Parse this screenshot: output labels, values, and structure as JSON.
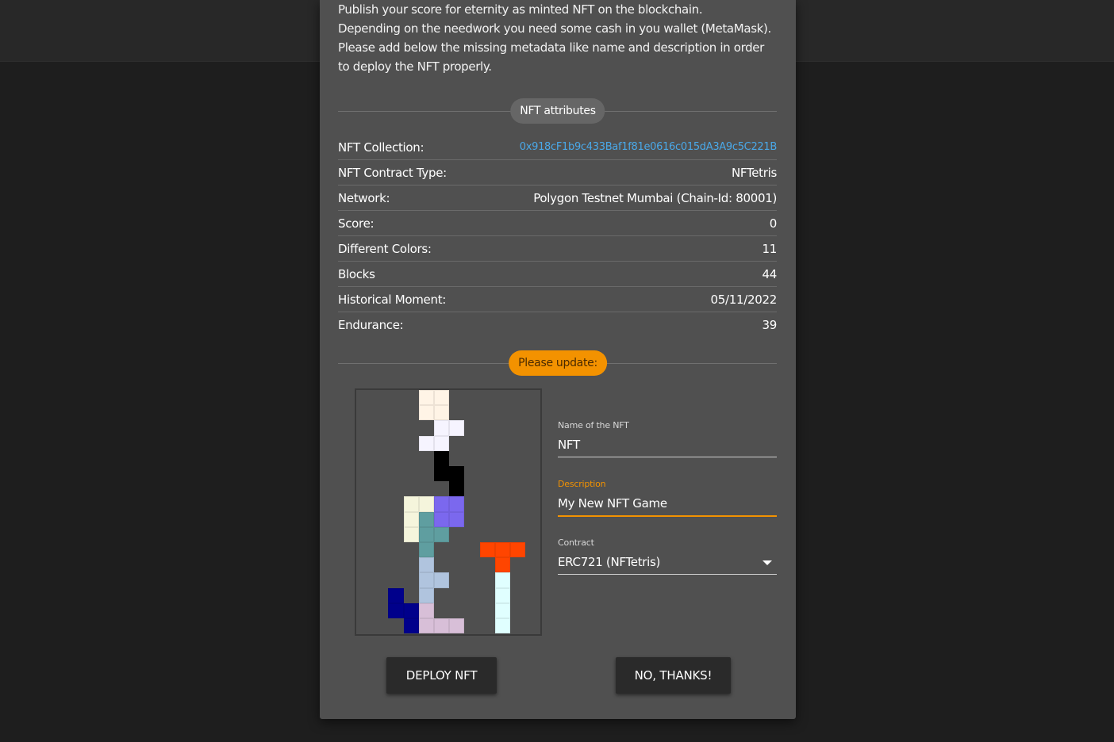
{
  "dialog": {
    "intro": "Publish your score for eternity as minted NFT on the blockchain.\nDepending on the needwork you need some cash in you wallet (MetaMask).\nPlease add below the missing metadata like name and description in order\nto deploy the NFT properly.",
    "attributes_chip": "NFT attributes",
    "attributes": [
      {
        "label": "NFT Collection:",
        "value": "0x918cF1b9c433Baf1f81e0616c015dA3A9c5C221B",
        "is_link": true
      },
      {
        "label": "NFT Contract Type:",
        "value": "NFTetris"
      },
      {
        "label": "Network:",
        "value": "Polygon Testnet Mumbai (Chain-Id: 80001)"
      },
      {
        "label": "Score:",
        "value": "0"
      },
      {
        "label": "Different Colors:",
        "value": "11"
      },
      {
        "label": "Blocks",
        "value": "44"
      },
      {
        "label": "Historical Moment:",
        "value": "05/11/2022"
      },
      {
        "label": "Endurance:",
        "value": "39"
      }
    ],
    "update_chip": "Please update:",
    "form": {
      "name_label": "Name of the NFT",
      "name_value": "NFT",
      "description_label": "Description",
      "description_value": "My New NFT Game",
      "contract_label": "Contract",
      "contract_value": "ERC721 (NFTetris)"
    },
    "buttons": {
      "deploy": "DEPLOY NFT",
      "decline": "NO, THANKS!"
    }
  },
  "colors": {
    "accent": "#f39200",
    "link": "#4aa8e8",
    "dialog_bg": "#505050"
  },
  "board": {
    "columns": 12,
    "rows": 16,
    "cells": [
      {
        "c": 4,
        "r": 0,
        "color": "#fff4e6"
      },
      {
        "c": 5,
        "r": 0,
        "color": "#fff4e6"
      },
      {
        "c": 4,
        "r": 1,
        "color": "#fff4e6"
      },
      {
        "c": 5,
        "r": 1,
        "color": "#fff4e6"
      },
      {
        "c": 5,
        "r": 2,
        "color": "#f6f4ff"
      },
      {
        "c": 6,
        "r": 2,
        "color": "#f6f4ff"
      },
      {
        "c": 4,
        "r": 3,
        "color": "#f6f4ff"
      },
      {
        "c": 5,
        "r": 3,
        "color": "#f6f4ff"
      },
      {
        "c": 5,
        "r": 4,
        "color": "#000000"
      },
      {
        "c": 5,
        "r": 5,
        "color": "#000000"
      },
      {
        "c": 6,
        "r": 5,
        "color": "#000000"
      },
      {
        "c": 6,
        "r": 6,
        "color": "#000000"
      },
      {
        "c": 3,
        "r": 7,
        "color": "#f5f5dc"
      },
      {
        "c": 4,
        "r": 7,
        "color": "#f5f5dc"
      },
      {
        "c": 3,
        "r": 8,
        "color": "#f5f5dc"
      },
      {
        "c": 3,
        "r": 9,
        "color": "#f5f5dc"
      },
      {
        "c": 5,
        "r": 7,
        "color": "#7b68ee"
      },
      {
        "c": 6,
        "r": 7,
        "color": "#7b68ee"
      },
      {
        "c": 5,
        "r": 8,
        "color": "#7b68ee"
      },
      {
        "c": 6,
        "r": 8,
        "color": "#7b68ee"
      },
      {
        "c": 4,
        "r": 8,
        "color": "#5f9ea0"
      },
      {
        "c": 4,
        "r": 9,
        "color": "#5f9ea0"
      },
      {
        "c": 5,
        "r": 9,
        "color": "#5f9ea0"
      },
      {
        "c": 4,
        "r": 10,
        "color": "#5f9ea0"
      },
      {
        "c": 4,
        "r": 11,
        "color": "#b0c4de"
      },
      {
        "c": 4,
        "r": 12,
        "color": "#b0c4de"
      },
      {
        "c": 5,
        "r": 12,
        "color": "#b0c4de"
      },
      {
        "c": 4,
        "r": 13,
        "color": "#b0c4de"
      },
      {
        "c": 2,
        "r": 13,
        "color": "#00008b"
      },
      {
        "c": 2,
        "r": 14,
        "color": "#00008b"
      },
      {
        "c": 3,
        "r": 14,
        "color": "#00008b"
      },
      {
        "c": 3,
        "r": 15,
        "color": "#00008b"
      },
      {
        "c": 4,
        "r": 14,
        "color": "#d8bfd8"
      },
      {
        "c": 4,
        "r": 15,
        "color": "#d8bfd8"
      },
      {
        "c": 5,
        "r": 15,
        "color": "#d8bfd8"
      },
      {
        "c": 6,
        "r": 15,
        "color": "#d8bfd8"
      },
      {
        "c": 8,
        "r": 10,
        "color": "#ff4500"
      },
      {
        "c": 9,
        "r": 10,
        "color": "#ff4500"
      },
      {
        "c": 10,
        "r": 10,
        "color": "#ff4500"
      },
      {
        "c": 9,
        "r": 11,
        "color": "#ff4500"
      },
      {
        "c": 9,
        "r": 12,
        "color": "#e0ffff"
      },
      {
        "c": 9,
        "r": 13,
        "color": "#e0ffff"
      },
      {
        "c": 9,
        "r": 14,
        "color": "#e0ffff"
      },
      {
        "c": 9,
        "r": 15,
        "color": "#e0ffff"
      }
    ]
  }
}
